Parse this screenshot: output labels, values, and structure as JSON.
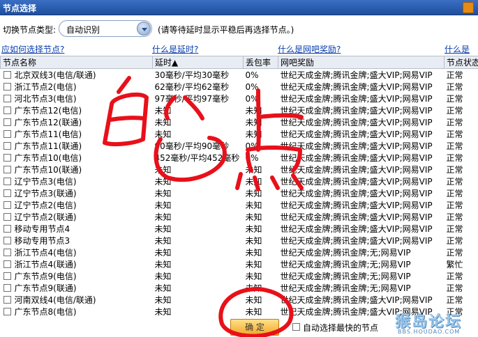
{
  "window": {
    "title": "节点选择"
  },
  "type_row": {
    "label": "切换节点类型:",
    "selected": "自动识别",
    "hint": "(请等待延时显示平稳后再选择节点。)"
  },
  "links": [
    {
      "text": "应如何选择节点?"
    },
    {
      "text": "什么是延时?"
    },
    {
      "text": "什么是网吧奖励?"
    },
    {
      "text": "什么是"
    }
  ],
  "columns": [
    "节点名称",
    "延时▲",
    "丢包率",
    "网吧奖励",
    "节点状态"
  ],
  "rows": [
    {
      "name": "北京双线3(电信/联通)",
      "latency": "30毫秒/平均30毫秒",
      "loss": "0%",
      "reward": "世纪天成金牌;腾讯金牌;盛大VIP;网易VIP",
      "status": "正常"
    },
    {
      "name": "浙江节点2(电信)",
      "latency": "62毫秒/平均62毫秒",
      "loss": "0%",
      "reward": "世纪天成金牌;腾讯金牌;盛大VIP;网易VIP",
      "status": "正常"
    },
    {
      "name": "河北节点3(电信)",
      "latency": "97毫秒/平均97毫秒",
      "loss": "0%",
      "reward": "世纪天成金牌;腾讯金牌;盛大VIP;网易VIP",
      "status": "正常"
    },
    {
      "name": "广东节点12(电信)",
      "latency": "未知",
      "loss": "未知",
      "reward": "世纪天成金牌;腾讯金牌;盛大VIP;网易VIP",
      "status": "正常"
    },
    {
      "name": "广东节点12(联通)",
      "latency": "未知",
      "loss": "未知",
      "reward": "世纪天成金牌;腾讯金牌;盛大VIP;网易VIP",
      "status": "正常"
    },
    {
      "name": "广东节点11(电信)",
      "latency": "未知",
      "loss": "未知",
      "reward": "世纪天成金牌;腾讯金牌;盛大VIP;网易VIP",
      "status": "正常"
    },
    {
      "name": "广东节点11(联通)",
      "latency": "90毫秒/平均90毫秒",
      "loss": "0%",
      "reward": "世纪天成金牌;腾讯金牌;盛大VIP;网易VIP",
      "status": "正常"
    },
    {
      "name": "广东节点10(电信)",
      "latency": "452毫秒/平均452毫秒",
      "loss": "0%",
      "reward": "世纪天成金牌;腾讯金牌;盛大VIP;网易VIP",
      "status": "正常"
    },
    {
      "name": "广东节点10(联通)",
      "latency": "未知",
      "loss": "未知",
      "reward": "世纪天成金牌;腾讯金牌;盛大VIP;网易VIP",
      "status": "正常"
    },
    {
      "name": "辽宁节点3(电信)",
      "latency": "未知",
      "loss": "未知",
      "reward": "世纪天成金牌;腾讯金牌;盛大VIP;网易VIP",
      "status": "正常"
    },
    {
      "name": "辽宁节点3(联通)",
      "latency": "未知",
      "loss": "未知",
      "reward": "世纪天成金牌;腾讯金牌;盛大VIP;网易VIP",
      "status": "正常"
    },
    {
      "name": "辽宁节点2(电信)",
      "latency": "未知",
      "loss": "未知",
      "reward": "世纪天成金牌;腾讯金牌;盛大VIP;网易VIP",
      "status": "正常"
    },
    {
      "name": "辽宁节点2(联通)",
      "latency": "未知",
      "loss": "未知",
      "reward": "世纪天成金牌;腾讯金牌;盛大VIP;网易VIP",
      "status": "正常"
    },
    {
      "name": "移动专用节点4",
      "latency": "未知",
      "loss": "未知",
      "reward": "世纪天成金牌;腾讯金牌;盛大VIP;网易VIP",
      "status": "正常"
    },
    {
      "name": "移动专用节点3",
      "latency": "未知",
      "loss": "未知",
      "reward": "世纪天成金牌;腾讯金牌;盛大VIP;网易VIP",
      "status": "正常"
    },
    {
      "name": "浙江节点4(电信)",
      "latency": "未知",
      "loss": "未知",
      "reward": "世纪天成金牌;腾讯金牌;无;网易VIP",
      "status": "正常"
    },
    {
      "name": "浙江节点4(联通)",
      "latency": "未知",
      "loss": "未知",
      "reward": "世纪天成金牌;腾讯金牌;无;网易VIP",
      "status": "繁忙"
    },
    {
      "name": "广东节点9(电信)",
      "latency": "未知",
      "loss": "未知",
      "reward": "世纪天成金牌;腾讯金牌;无;网易VIP",
      "status": "正常"
    },
    {
      "name": "广东节点9(联通)",
      "latency": "未知",
      "loss": "未知",
      "reward": "世纪天成金牌;腾讯金牌;无;网易VIP",
      "status": "正常"
    },
    {
      "name": "河南双线4(电信/联通)",
      "latency": "未知",
      "loss": "未知",
      "reward": "世纪天成金牌;腾讯金牌;盛大VIP;网易VIP",
      "status": "正常"
    },
    {
      "name": "广东节点8(电信)",
      "latency": "未知",
      "loss": "未知",
      "reward": "世纪天成金牌;腾讯金牌;盛大VIP;网易VIP",
      "status": "正常"
    }
  ],
  "footer": {
    "ok": "确 定",
    "auto_label": "自动选择最快的节点"
  },
  "watermark": {
    "text": "猴岛论坛",
    "sub": "BBS.HOUDAO.COM"
  },
  "colors": {
    "title_bar": "#2a5db0",
    "link": "#0a3fb0",
    "button": "#f2a825",
    "annotation": "#e8101a"
  }
}
